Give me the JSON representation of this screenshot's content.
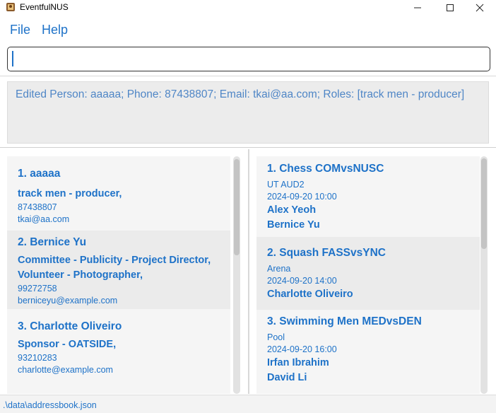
{
  "window": {
    "title": "EventfulNUS"
  },
  "menu": {
    "file": "File",
    "help": "Help"
  },
  "command": {
    "value": "",
    "placeholder": ""
  },
  "result": {
    "text": "Edited Person: aaaaa; Phone: 87438807; Email: tkai@aa.com; Roles: [track men - producer]"
  },
  "persons": [
    {
      "name": "1. aaaaa",
      "roles": [
        "track men - producer,"
      ],
      "phone": "87438807",
      "email": "tkai@aa.com"
    },
    {
      "name": "2. Bernice Yu",
      "roles": [
        "Committee - Publicity - Project Director,",
        "Volunteer - Photographer,"
      ],
      "phone": "99272758",
      "email": "berniceyu@example.com"
    },
    {
      "name": "3. Charlotte Oliveiro",
      "roles": [
        "Sponsor - OATSIDE,"
      ],
      "phone": "93210283",
      "email": "charlotte@example.com"
    }
  ],
  "events": [
    {
      "name": "1. Chess COMvsNUSC",
      "venue": "UT AUD2",
      "datetime": "2024-09-20 10:00",
      "participants": [
        "Alex Yeoh",
        "Bernice Yu"
      ]
    },
    {
      "name": "2. Squash FASSvsYNC",
      "venue": "Arena",
      "datetime": "2024-09-20 14:00",
      "participants": [
        "Charlotte Oliveiro"
      ]
    },
    {
      "name": "3. Swimming Men MEDvsDEN",
      "venue": "Pool",
      "datetime": "2024-09-20 16:00",
      "participants": [
        "Irfan Ibrahim",
        "David Li"
      ]
    }
  ],
  "status": {
    "path": ".\\data\\addressbook.json"
  },
  "colors": {
    "accent": "#1e72c8",
    "card_odd": "#f5f5f5",
    "card_even": "#ebebeb",
    "result_bg": "#ececec"
  }
}
